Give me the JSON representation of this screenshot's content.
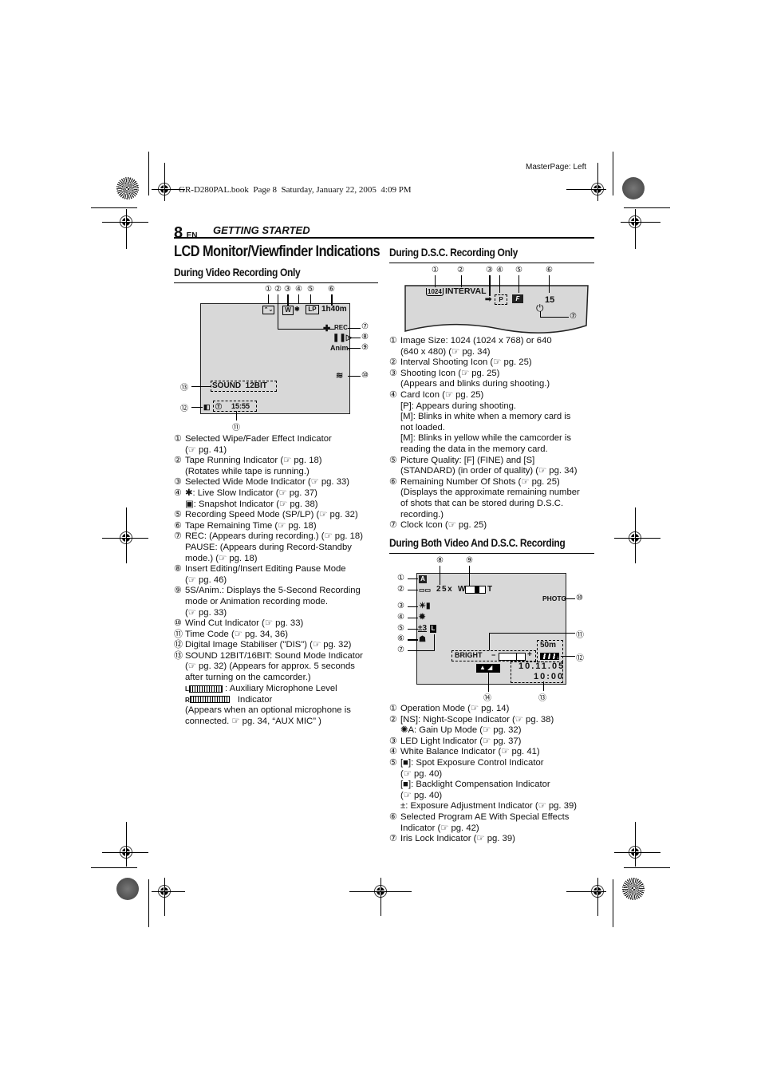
{
  "slug": {
    "master_page": "MasterPage: Left",
    "book_line": "GR-D280PAL.book  Page 8  Saturday, January 22, 2005  4:09 PM"
  },
  "header": {
    "page_number": "8",
    "lang": "EN",
    "section": "GETTING STARTED"
  },
  "title": "LCD Monitor/Viewfinder Indications",
  "video_section": {
    "heading": "During Video Recording Only",
    "diagram": {
      "callouts": [
        "①",
        "②",
        "③",
        "④",
        "⑤",
        "⑥",
        "⑦",
        "⑧",
        "⑨",
        "⑩",
        "⑪",
        "⑫",
        "⑬"
      ],
      "tape_remaining": "1h40m",
      "speed_mode": "LP",
      "wide_icon": "W",
      "rec": "REC",
      "anim": "Anim.",
      "sound": "SOUND  12BIT",
      "time_code": "15:55"
    },
    "items": [
      {
        "n": "①",
        "lines": [
          "Selected Wipe/Fader Effect Indicator",
          "(☞ pg. 41)"
        ]
      },
      {
        "n": "②",
        "lines": [
          "Tape Running Indicator (☞ pg. 18)",
          "(Rotates while tape is running.)"
        ]
      },
      {
        "n": "③",
        "lines": [
          "Selected Wide Mode Indicator (☞ pg. 33)"
        ]
      },
      {
        "n": "④",
        "lines": [
          "✱: Live Slow Indicator (☞ pg. 37)",
          "▣: Snapshot Indicator (☞ pg. 38)"
        ]
      },
      {
        "n": "⑤",
        "lines": [
          "Recording Speed Mode (SP/LP) (☞ pg. 32)"
        ]
      },
      {
        "n": "⑥",
        "lines": [
          "Tape Remaining Time (☞ pg. 18)"
        ]
      },
      {
        "n": "⑦",
        "lines": [
          "REC: (Appears during recording.) (☞ pg. 18)",
          "PAUSE: (Appears during Record-Standby",
          "mode.) (☞ pg. 18)"
        ]
      },
      {
        "n": "⑧",
        "lines": [
          "Insert Editing/Insert Editing Pause Mode",
          "(☞ pg. 46)"
        ]
      },
      {
        "n": "⑨",
        "lines": [
          "5S/Anim.: Displays the 5-Second Recording",
          "mode or Animation recording mode.",
          "(☞ pg. 33)"
        ]
      },
      {
        "n": "⑩",
        "lines": [
          "Wind Cut Indicator (☞ pg. 33)"
        ]
      },
      {
        "n": "⑪",
        "lines": [
          "Time Code (☞ pg. 34, 36)"
        ]
      },
      {
        "n": "⑫",
        "lines": [
          "Digital Image Stabiliser (\"DIS\") (☞ pg. 32)"
        ]
      },
      {
        "n": "⑬",
        "lines": [
          "SOUND 12BIT/16BIT: Sound Mode Indicator",
          "(☞ pg. 32) (Appears for approx. 5 seconds",
          "after turning on the camcorder.)"
        ]
      }
    ],
    "aux_mic": {
      "l_label": "L",
      "r_label": "R",
      "line1": ": Auxiliary Microphone Level",
      "line2": "Indicator",
      "note1": "(Appears when an optional microphone is",
      "note2": "connected. ☞ pg. 34, “AUX MIC” )"
    }
  },
  "dsc_section": {
    "heading": "During D.S.C. Recording Only",
    "diagram": {
      "callouts": [
        "①",
        "②",
        "③",
        "④",
        "⑤",
        "⑥",
        "⑦"
      ],
      "image_size": "1024",
      "interval": "INTERVAL",
      "card": "P",
      "quality": "F",
      "shots": "15"
    },
    "items": [
      {
        "n": "①",
        "lines": [
          "Image Size: 1024 (1024 x 768) or 640",
          "(640 x 480) (☞ pg. 34)"
        ]
      },
      {
        "n": "②",
        "lines": [
          "Interval Shooting Icon (☞ pg. 25)"
        ]
      },
      {
        "n": "③",
        "lines": [
          "Shooting Icon (☞ pg. 25)",
          "(Appears and blinks during shooting.)"
        ]
      },
      {
        "n": "④",
        "lines": [
          "Card Icon (☞ pg. 25)",
          "[P]: Appears during shooting.",
          "[M]: Blinks in white when a memory card is",
          "not loaded.",
          "[M]: Blinks in yellow while the camcorder is",
          "reading the data in the memory card."
        ]
      },
      {
        "n": "⑤",
        "lines": [
          "Picture Quality: [F] (FINE) and [S]",
          "(STANDARD) (in order of quality) (☞ pg. 34)"
        ]
      },
      {
        "n": "⑥",
        "lines": [
          "Remaining Number Of Shots (☞ pg. 25)",
          "(Displays the approximate remaining number",
          "of shots that can be stored during D.S.C.",
          "recording.)"
        ]
      },
      {
        "n": "⑦",
        "lines": [
          "Clock Icon (☞ pg. 25)"
        ]
      }
    ]
  },
  "both_section": {
    "heading": "During Both Video And D.S.C. Recording",
    "diagram": {
      "callouts": [
        "①",
        "②",
        "③",
        "④",
        "⑤",
        "⑥",
        "⑦",
        "⑧",
        "⑨",
        "⑩",
        "⑪",
        "⑫",
        "⑬",
        "⑭"
      ],
      "zoom": "25x",
      "zoom_w": "W",
      "zoom_t": "T",
      "photo": "PHOTO",
      "exposure": "±3",
      "iris": "L",
      "bright": "BRIGHT",
      "bright_minus": "−",
      "bright_plus": "+",
      "tape": "50m",
      "date": "10.11.05",
      "time": "10:00",
      "mode": "A"
    },
    "items": [
      {
        "n": "①",
        "lines": [
          "Operation Mode (☞ pg. 14)"
        ]
      },
      {
        "n": "②",
        "lines": [
          "[NS]: Night-Scope Indicator (☞ pg. 38)",
          "✺A: Gain Up Mode (☞ pg. 32)"
        ]
      },
      {
        "n": "③",
        "lines": [
          "LED Light Indicator (☞ pg. 37)"
        ]
      },
      {
        "n": "④",
        "lines": [
          "White Balance Indicator (☞ pg. 41)"
        ]
      },
      {
        "n": "⑤",
        "lines": [
          "[■]: Spot Exposure Control Indicator",
          "(☞ pg. 40)",
          "[■]: Backlight Compensation Indicator",
          "(☞ pg. 40)",
          "±: Exposure Adjustment Indicator (☞ pg. 39)"
        ]
      },
      {
        "n": "⑥",
        "lines": [
          "Selected Program AE With Special Effects",
          "Indicator (☞ pg. 42)"
        ]
      },
      {
        "n": "⑦",
        "lines": [
          "Iris Lock Indicator (☞ pg. 39)"
        ]
      }
    ]
  }
}
